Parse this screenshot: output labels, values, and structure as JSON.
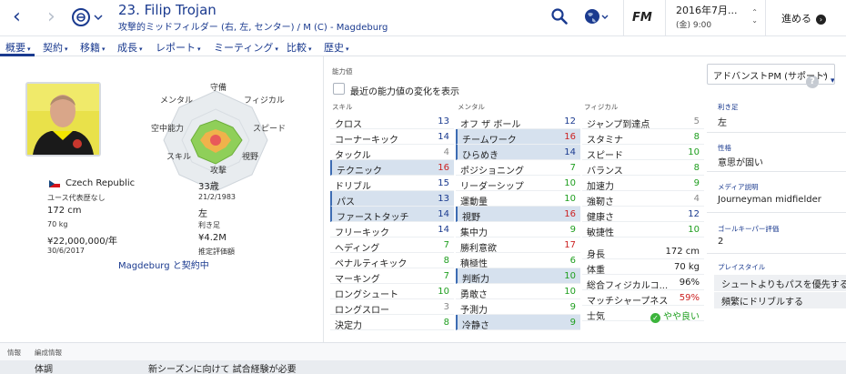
{
  "header": {
    "name": "23. Filip Trojan",
    "subtitle": "攻撃的ミッドフィルダー (右, 左, センター) / M (C) - Magdeburg",
    "app_logo": "FM",
    "date_line1": "2016年7月...",
    "date_line2": "(金) 9:00",
    "continue_label": "進める"
  },
  "menu": [
    {
      "label": "概要"
    },
    {
      "label": "契約"
    },
    {
      "label": "移籍"
    },
    {
      "label": "成長"
    },
    {
      "label": "レポート"
    },
    {
      "label": "ミーティング"
    },
    {
      "label": "比較"
    },
    {
      "label": "歴史"
    }
  ],
  "radar": {
    "labels": [
      "守備",
      "フィジカル",
      "スピード",
      "視野",
      "攻撃",
      "スキル",
      "空中能力",
      "メンタル"
    ]
  },
  "player": {
    "nationality": "Czech Republic",
    "intl_caps": "ユース代表歴なし",
    "height": "172 cm",
    "weight": "70 kg",
    "wage": "¥22,000,000/年",
    "contract_end": "30/6/2017",
    "age": "33歳",
    "dob": "21/2/1983",
    "foot": "左",
    "foot_label": "利き足",
    "value": "¥4.2M",
    "value_label": "推定評価額",
    "contract_link": "Magdeburg と契約中"
  },
  "attributes": {
    "section_label": "能力値",
    "checkbox_label": "最近の能力値の変化を表示",
    "col_skill": "スキル",
    "col_mental": "メンタル",
    "col_physical": "フィジカル",
    "skill": [
      {
        "name": "クロス",
        "value": "13"
      },
      {
        "name": "コーナーキック",
        "value": "14"
      },
      {
        "name": "タックル",
        "value": "4"
      },
      {
        "name": "テクニック",
        "value": "16"
      },
      {
        "name": "ドリブル",
        "value": "15"
      },
      {
        "name": "パス",
        "value": "13"
      },
      {
        "name": "ファーストタッチ",
        "value": "14"
      },
      {
        "name": "フリーキック",
        "value": "14"
      },
      {
        "name": "ヘディング",
        "value": "7"
      },
      {
        "name": "ペナルティキック",
        "value": "8"
      },
      {
        "name": "マーキング",
        "value": "7"
      },
      {
        "name": "ロングシュート",
        "value": "10"
      },
      {
        "name": "ロングスロー",
        "value": "3"
      },
      {
        "name": "決定力",
        "value": "8"
      }
    ],
    "mental": [
      {
        "name": "オフ ザ ボール",
        "value": "12"
      },
      {
        "name": "チームワーク",
        "value": "16"
      },
      {
        "name": "ひらめき",
        "value": "14"
      },
      {
        "name": "ポジショニング",
        "value": "7"
      },
      {
        "name": "リーダーシップ",
        "value": "10"
      },
      {
        "name": "運動量",
        "value": "10"
      },
      {
        "name": "視野",
        "value": "16"
      },
      {
        "name": "集中力",
        "value": "9"
      },
      {
        "name": "勝利意欲",
        "value": "17"
      },
      {
        "name": "積極性",
        "value": "6"
      },
      {
        "name": "判断力",
        "value": "10"
      },
      {
        "name": "勇敢さ",
        "value": "10"
      },
      {
        "name": "予測力",
        "value": "9"
      },
      {
        "name": "冷静さ",
        "value": "9"
      }
    ],
    "physical": [
      {
        "name": "ジャンプ到達点",
        "value": "5"
      },
      {
        "name": "スタミナ",
        "value": "8"
      },
      {
        "name": "スピード",
        "value": "10"
      },
      {
        "name": "バランス",
        "value": "8"
      },
      {
        "name": "加速力",
        "value": "9"
      },
      {
        "name": "強靭さ",
        "value": "4"
      },
      {
        "name": "健康さ",
        "value": "12"
      },
      {
        "name": "敏捷性",
        "value": "10"
      }
    ],
    "info": [
      {
        "name": "身長",
        "value": "172 cm"
      },
      {
        "name": "体重",
        "value": "70 kg"
      },
      {
        "name": "総合フィジカルコ...",
        "value": "96%"
      },
      {
        "name": "マッチシャープネス",
        "value": "59%"
      },
      {
        "name": "士気",
        "value": "やや良い"
      }
    ]
  },
  "side": {
    "role": "アドバンストPM (サポート)",
    "foot_label": "利き足",
    "foot": "左",
    "personality_label": "性格",
    "personality": "意思が固い",
    "media_label": "メディア説明",
    "media": "Journeyman midfielder",
    "gk_label": "ゴールキーパー評価",
    "gk": "2",
    "playstyle_label": "プレイスタイル",
    "playstyles": [
      "シュートよりもパスを優先する",
      "頻繁にドリブルする"
    ]
  },
  "bottom": {
    "info_label": "情報",
    "training_label": "編成情報",
    "row_label": "体調",
    "row_text": "新シーズンに向けて 試合経験が必要"
  },
  "colors": {
    "accent": "#1a3a8f",
    "green": "#1e9e1e",
    "red": "#cc2222",
    "highlight": "#d6e1ee"
  }
}
